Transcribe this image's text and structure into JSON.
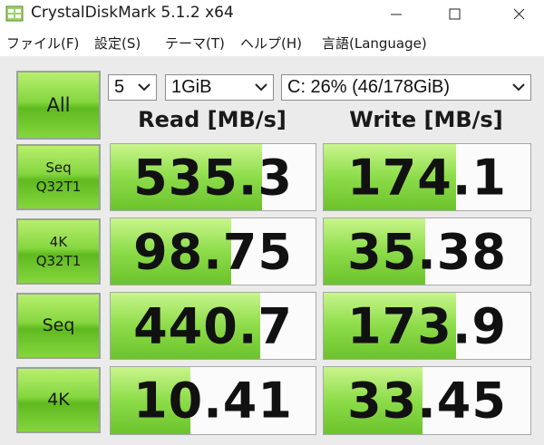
{
  "window": {
    "title": "CrystalDiskMark 5.1.2 x64"
  },
  "menu": [
    "ファイル(F)",
    "設定(S)",
    "テーマ(T)",
    "ヘルプ(H)",
    "言語(Language)"
  ],
  "controls": {
    "all_label": "All",
    "test_count": "5",
    "test_size": "1GiB",
    "drive": "C: 26% (46/178GiB)"
  },
  "columns": {
    "read": "Read [MB/s]",
    "write": "Write [MB/s]"
  },
  "tests": [
    {
      "label": "Seq\nQ32T1",
      "read": "535.3",
      "write": "174.1",
      "read_fill": 0.74,
      "write_fill": 0.64
    },
    {
      "label": "4K\nQ32T1",
      "read": "98.75",
      "write": "35.38",
      "read_fill": 0.59,
      "write_fill": 0.49
    },
    {
      "label": "Seq",
      "read": "440.7",
      "write": "173.9",
      "read_fill": 0.73,
      "write_fill": 0.64
    },
    {
      "label": "4K",
      "read": "10.41",
      "write": "33.45",
      "read_fill": 0.39,
      "write_fill": 0.48
    }
  ],
  "colors": {
    "accent_green": "#6cc32c",
    "button_green": "#85d63f"
  }
}
